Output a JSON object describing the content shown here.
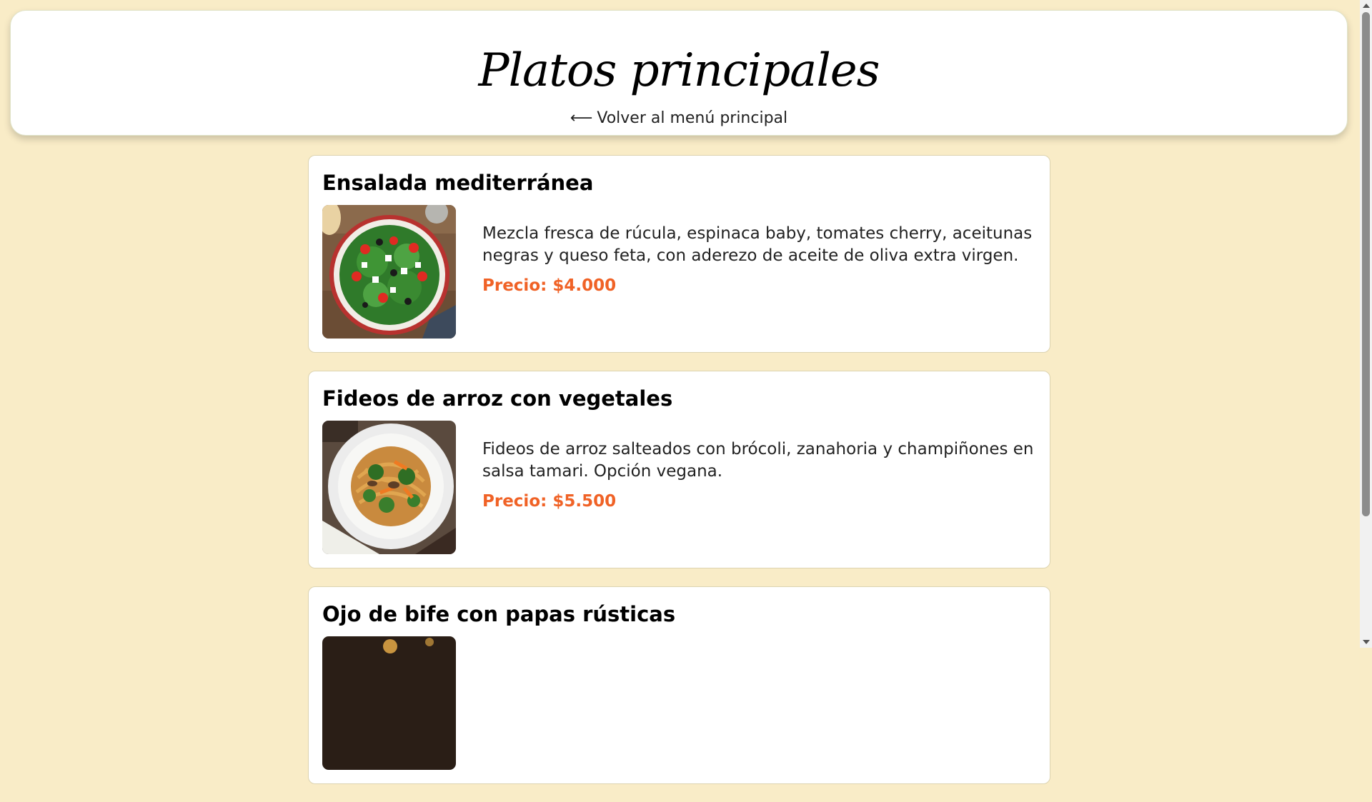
{
  "header": {
    "title": "Platos principales",
    "back_arrow": "⟵",
    "back_label": "Volver al menú principal"
  },
  "dishes": [
    {
      "name": "Ensalada mediterránea",
      "description": "Mezcla fresca de rúcula, espinaca baby, tomates cherry, aceitunas negras y queso feta, con aderezo de aceite de oliva extra virgen.",
      "price": "Precio: $4.000"
    },
    {
      "name": "Fideos de arroz con vegetales",
      "description": "Fideos de arroz salteados con brócoli, zanahoria y champiñones en salsa tamari. Opción vegana.",
      "price": "Precio: $5.500"
    },
    {
      "name": "Ojo de bife con papas rústicas",
      "description": "",
      "price": ""
    }
  ],
  "colors": {
    "background": "#f9ecc7",
    "price": "#f06226"
  }
}
